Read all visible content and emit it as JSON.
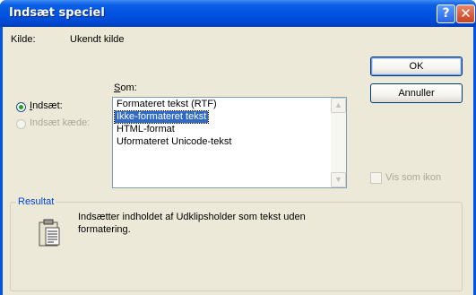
{
  "window": {
    "title": "Indsæt speciel"
  },
  "titlebar": {
    "help_label": "?",
    "close_label": "✕"
  },
  "source": {
    "label": "Kilde:",
    "value": "Ukendt kilde"
  },
  "buttons": {
    "ok": "OK",
    "cancel": "Annuller"
  },
  "as_label": "Som:",
  "options": {
    "paste": {
      "label": "Indsæt:",
      "checked": true,
      "enabled": true
    },
    "paste_link": {
      "label": "Indsæt kæde:",
      "checked": false,
      "enabled": false
    }
  },
  "formats": [
    {
      "label": "Formateret tekst (RTF)",
      "selected": false
    },
    {
      "label": "Ikke-formateret tekst",
      "selected": true
    },
    {
      "label": "HTML-format",
      "selected": false
    },
    {
      "label": "Uformateret Unicode-tekst",
      "selected": false
    }
  ],
  "display_as_icon": {
    "label": "Vis som ikon",
    "checked": false,
    "enabled": false
  },
  "result": {
    "title": "Resultat",
    "line1": "Indsætter indholdet af Udklipsholder som tekst uden",
    "line2": "formatering.",
    "icon": "clipboard-icon"
  },
  "colors": {
    "titlebar": "#0054e3",
    "dialog_bg": "#ece9d8",
    "selection": "#316ac5",
    "group_title": "#0046d5"
  }
}
